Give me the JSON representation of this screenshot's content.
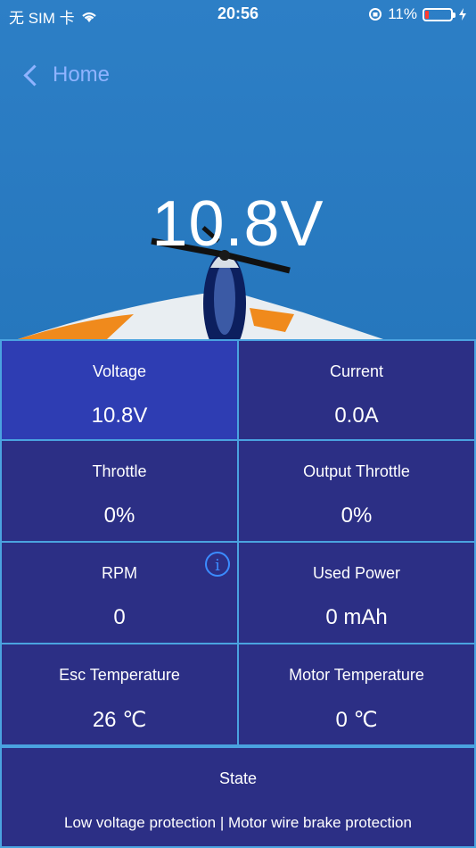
{
  "status_bar": {
    "carrier": "无 SIM 卡",
    "time": "20:56",
    "battery_percent": "11%"
  },
  "nav": {
    "back_label": "Home"
  },
  "hero_voltage": "10.8V",
  "cells": [
    {
      "label": "Voltage",
      "value": "10.8V"
    },
    {
      "label": "Current",
      "value": "0.0A"
    },
    {
      "label": "Throttle",
      "value": "0%"
    },
    {
      "label": "Output Throttle",
      "value": "0%"
    },
    {
      "label": "RPM",
      "value": "0"
    },
    {
      "label": "Used Power",
      "value": "0 mAh"
    },
    {
      "label": "Esc Temperature",
      "value": "26 ℃"
    },
    {
      "label": "Motor Temperature",
      "value": "0 ℃"
    }
  ],
  "state": {
    "label": "State",
    "value": "Low voltage protection | Motor wire brake protection"
  },
  "icons": {
    "info": "info-icon"
  },
  "colors": {
    "panel": "#2c2f85",
    "active_cell": "#2e3db3",
    "border": "#4aa3e0",
    "back": "#8fb3ff"
  }
}
